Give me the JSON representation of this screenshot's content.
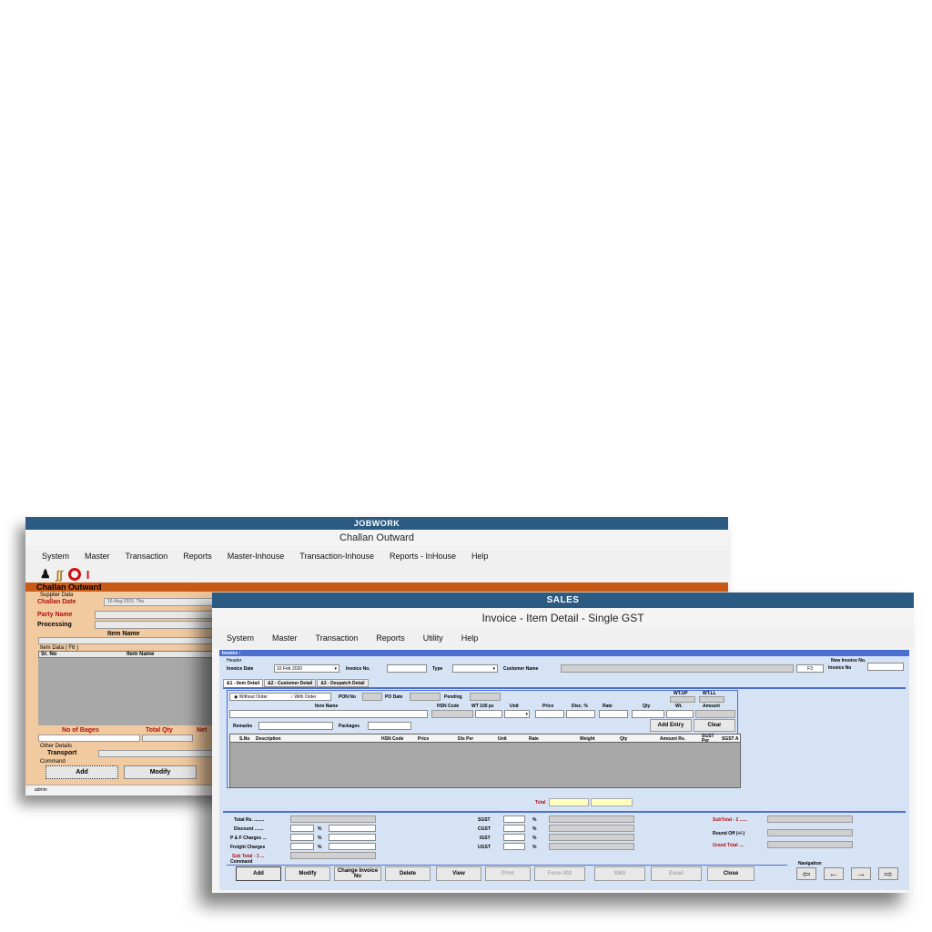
{
  "back": {
    "title": "JOBWORK",
    "subtitle": "Challan Outward",
    "menu": [
      "System",
      "Master",
      "Transaction",
      "Reports",
      "Master-Inhouse",
      "Transaction-Inhouse",
      "Reports - InHouse",
      "Help"
    ],
    "section_title": "Challan Outward",
    "supplier_data": "Supplier Data",
    "challan_date_label": "Challan Date",
    "challan_date_value": "16-Aug-2015, Thu",
    "party_name_label": "Party Name",
    "processing_label": "Processing",
    "item_name_label": "Item Name",
    "item_data_label": "Item Data ( F6 )",
    "grid_cols": [
      "Sr. No",
      "Item Name"
    ],
    "no_of_bages": "No of Bages",
    "total_qty": "Total Qty",
    "net_label": "Net",
    "other_details": "Other Details",
    "transport": "Transport",
    "command": "Command",
    "add": "Add",
    "modify": "Modify",
    "status_user": "admin"
  },
  "front": {
    "title": "SALES",
    "subtitle": "Invoice - Item Detail - Single GST",
    "menu": [
      "System",
      "Master",
      "Transaction",
      "Reports",
      "Utility",
      "Help"
    ],
    "invoice_section": "Invoice :",
    "header_label": "Header",
    "invoice_date_label": "Invoice Date",
    "invoice_date_value": "10 Feb 2020",
    "invoice_no_label": "Invoice No.",
    "type_label": "Type",
    "customer_name_label": "Customer Name",
    "f3": "F3",
    "new_invoice_no_label": "New Invoice No.",
    "invoice_no_label2": "Invoice No",
    "tabs": [
      "&1 - Item Detail",
      "&2 - Customer Detail",
      "&3 - Despatch Detail"
    ],
    "without_order": "Without Order",
    "with_order": "With Order",
    "pon_no": "PON No",
    "po_date": "PO Date",
    "pending": "Pending",
    "wt_up": "WT.UP",
    "wt_ll": "WT.LL",
    "item_name": "Item Name",
    "hsn_code": "HSN Code",
    "wt100": "WT 100 pc",
    "unit": "Unit",
    "price": "Price",
    "disc": "Disc. %",
    "rate": "Rate",
    "qty": "Qty",
    "wt": "Wt.",
    "amount": "Amount",
    "remarks": "Remarks",
    "packages": "Packages",
    "add_entry": "Add Entry",
    "clear": "Clear",
    "grid_cols": [
      "S.No",
      "Description",
      "HSN Code",
      "Price",
      "Dis Per",
      "Unit",
      "Rate",
      "Weight",
      "Qty",
      "Amount Rs.",
      "SGST Per",
      "SGST A"
    ],
    "total": "Total",
    "total_rs": "Total Rs. ........",
    "discount": "Discount .......",
    "pf_charges": "P & F Charges ...",
    "freight": "Freight Charges",
    "subtotal1": "Sub Total - 1 ...",
    "sgst": "SGST",
    "cgst": "CGST",
    "igst": "IGST",
    "ugst": "UGST",
    "pct": "%",
    "subtotal2": "SubTotal - 2 ......",
    "round_off": "Round Off (+/-)",
    "grand_total": "Grand Total ....",
    "command": "Command",
    "navigation": "Navigation",
    "buttons": [
      "Add",
      "Modify",
      "Change Invoice No",
      "Delete",
      "View",
      "Print",
      "Form 402",
      "SMS",
      "Email",
      "Close"
    ]
  },
  "colors": {
    "titlebar": "#2b5a82",
    "section_orange": "#c85a18",
    "form_peach": "#f2caa0",
    "form_blue": "#d6e3f5",
    "strip_blue": "#4a6fd0"
  }
}
